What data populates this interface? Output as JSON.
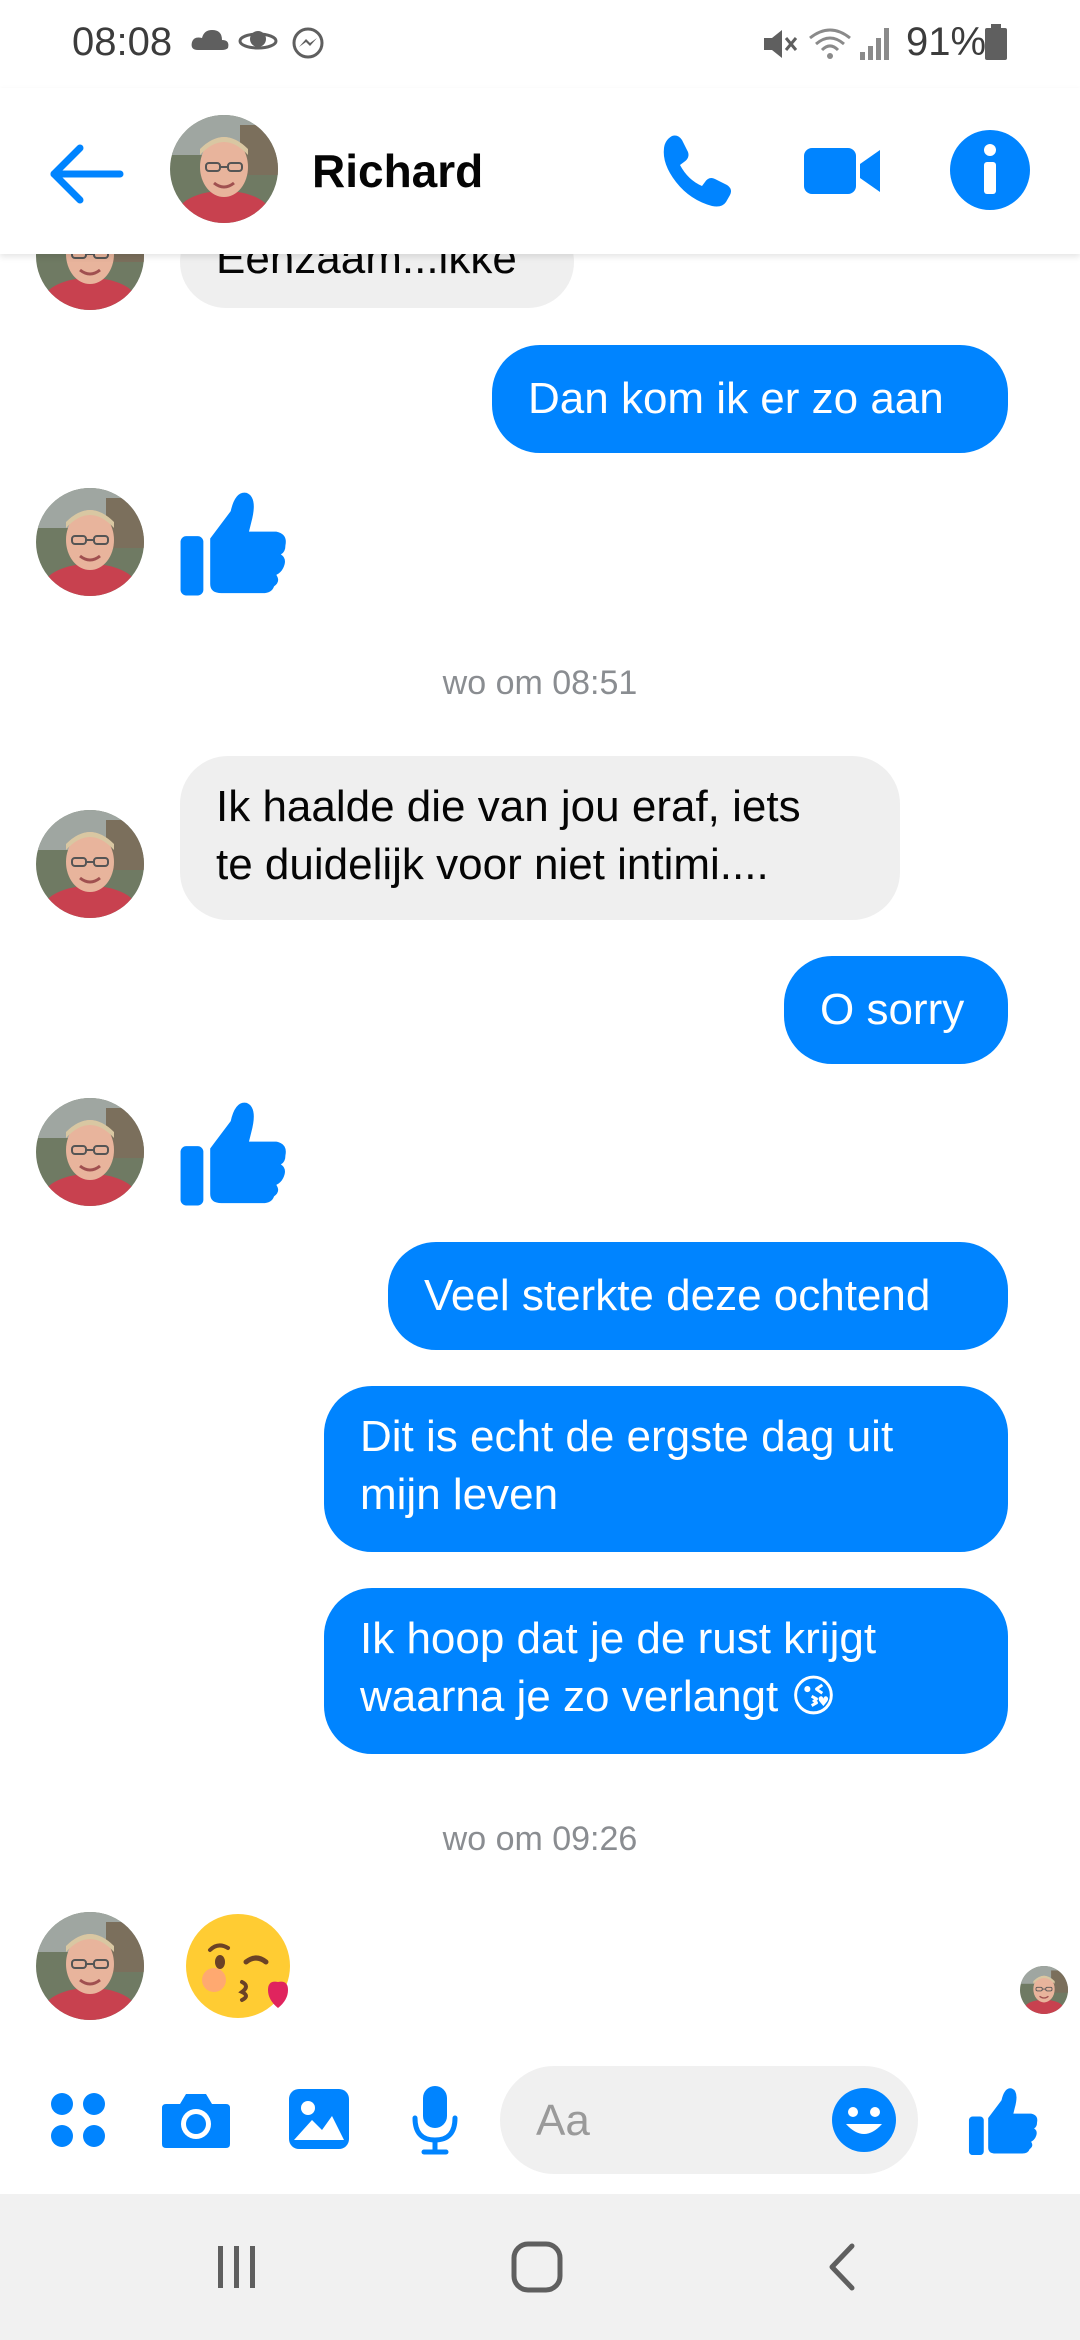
{
  "status_bar": {
    "time": "08:08",
    "battery": "91%",
    "icons": [
      "cloud-icon",
      "saturn-icon",
      "messenger-icon",
      "mute-icon",
      "wifi-icon",
      "signal-icon",
      "battery-icon"
    ]
  },
  "header": {
    "contact_name": "Richard",
    "actions": [
      "back-arrow-icon",
      "phone-icon",
      "video-icon",
      "info-icon"
    ]
  },
  "messages": [
    {
      "side": "in",
      "text": "Eenzaam...ikke"
    },
    {
      "side": "out",
      "text": "Dan kom ik er zo aan"
    },
    {
      "side": "in",
      "type": "thumbs-up"
    },
    {
      "type": "timestamp",
      "text": "wo om 08:51"
    },
    {
      "side": "in",
      "line1": "Ik haalde die van jou eraf, iets",
      "line2": "te duidelijk voor niet intimi...."
    },
    {
      "side": "out",
      "text": "O sorry"
    },
    {
      "side": "in",
      "type": "thumbs-up"
    },
    {
      "side": "out",
      "text": "Veel sterkte deze ochtend"
    },
    {
      "side": "out",
      "line1": "Dit is echt de ergste dag uit",
      "line2": "mijn leven"
    },
    {
      "side": "out",
      "line1": "Ik hoop dat je de rust krijgt",
      "line2": "waarna je zo verlangt",
      "emoji": "😘"
    },
    {
      "type": "timestamp",
      "text": "wo om 09:26"
    },
    {
      "side": "in",
      "type": "emoji",
      "emoji": "😘"
    }
  ],
  "composer": {
    "placeholder": "Aa",
    "icons": [
      "apps-icon",
      "camera-icon",
      "gallery-icon",
      "microphone-icon",
      "emoji-icon",
      "like-icon"
    ]
  },
  "colors": {
    "accent": "#0084ff",
    "incoming_bubble": "#efefef"
  }
}
